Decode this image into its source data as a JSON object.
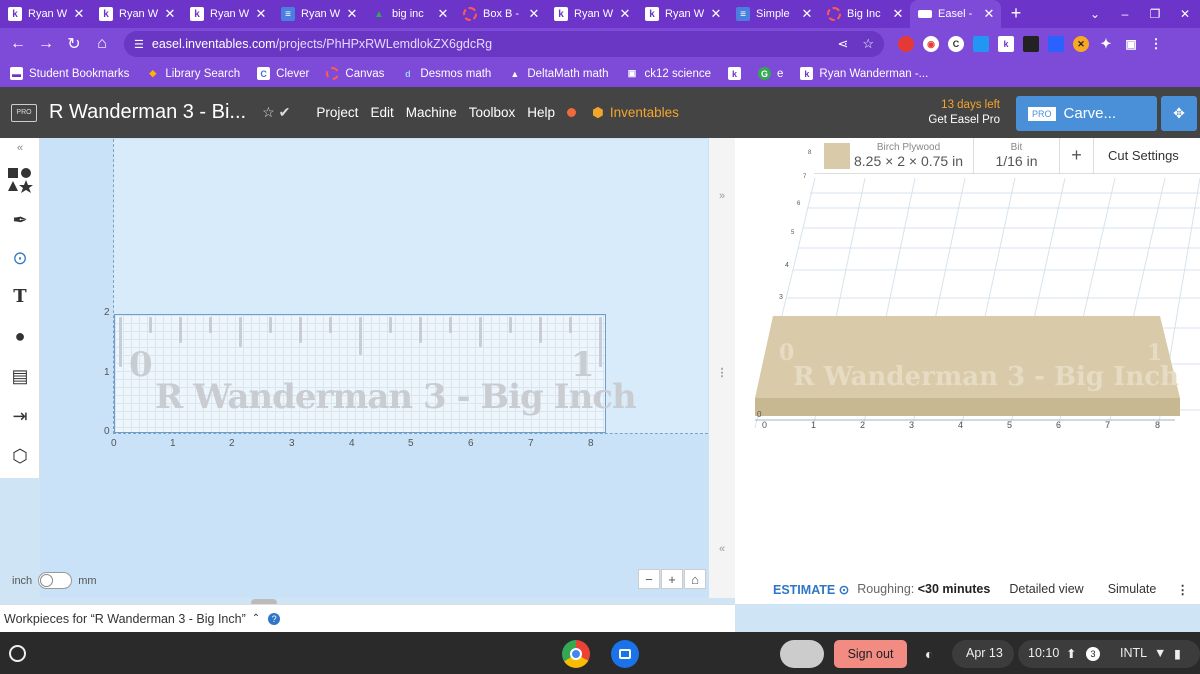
{
  "tabs": [
    {
      "title": "Ryan W",
      "icon": "kami-icon"
    },
    {
      "title": "Ryan W",
      "icon": "kami-icon"
    },
    {
      "title": "Ryan W",
      "icon": "kami-icon"
    },
    {
      "title": "Ryan W",
      "icon": "docs-icon"
    },
    {
      "title": "big inc",
      "icon": "drive-icon"
    },
    {
      "title": "Box B -",
      "icon": "loading-ring-icon"
    },
    {
      "title": "Ryan W",
      "icon": "kami-icon"
    },
    {
      "title": "Ryan W",
      "icon": "kami-icon"
    },
    {
      "title": "Simple",
      "icon": "docs-icon"
    },
    {
      "title": "Big Inc",
      "icon": "loading-ring-icon"
    },
    {
      "title": "Easel -",
      "icon": "easel-icon",
      "active": true
    }
  ],
  "browser": {
    "url_host": "easel.inventables.com",
    "url_path": "/projects/PhHPxRWLemdlokZX6gdcRg"
  },
  "bookmarks": [
    {
      "label": "Student Bookmarks",
      "icon": "folder-icon"
    },
    {
      "label": "Library Search",
      "icon": "library-icon"
    },
    {
      "label": "Clever",
      "icon": "clever-icon"
    },
    {
      "label": "Canvas",
      "icon": "canvas-icon"
    },
    {
      "label": "Desmos math",
      "icon": "desmos-icon"
    },
    {
      "label": "DeltaMath math",
      "icon": "deltamath-icon"
    },
    {
      "label": "ck12 science",
      "icon": "ck12-icon"
    },
    {
      "label": "",
      "icon": "kami-icon"
    },
    {
      "label": "e",
      "icon": "g-icon"
    },
    {
      "label": "Ryan Wanderman -...",
      "icon": "kami-icon"
    }
  ],
  "easel": {
    "pro_logo": "PRO",
    "project_title": "R Wanderman 3 - Bi...",
    "menu": [
      "Project",
      "Edit",
      "Machine",
      "Toolbox",
      "Help"
    ],
    "inventables": "Inventables",
    "trial_days": "13 days left",
    "trial_cta": "Get Easel Pro",
    "carve_label": "Carve...",
    "carve_badge": "PRO"
  },
  "design": {
    "ruler_text": "R Wanderman 3 - Big Inch",
    "mark_start": "0",
    "mark_end": "1",
    "x_ticks": [
      "0",
      "1",
      "2",
      "3",
      "4",
      "5",
      "6",
      "7",
      "8"
    ],
    "y_ticks": [
      "0",
      "1",
      "2"
    ],
    "unit_left": "inch",
    "unit_right": "mm",
    "zoom_out": "−",
    "zoom_in": "+"
  },
  "material": {
    "name": "Birch Plywood",
    "dims": "8.25 × 2 × 0.75 in",
    "bit_caption": "Bit",
    "bit_value": "1/16 in",
    "add": "+",
    "cut_settings": "Cut Settings"
  },
  "preview": {
    "x_ticks": [
      "0",
      "1",
      "2",
      "3",
      "4",
      "5",
      "6",
      "7",
      "8"
    ],
    "y_ticks": [
      "3",
      "4",
      "5",
      "6",
      "7",
      "8"
    ]
  },
  "estimate": {
    "label": "ESTIMATE",
    "roughing_label": "Roughing:",
    "roughing_value": "<30 minutes",
    "detailed": "Detailed view",
    "simulate": "Simulate"
  },
  "workpieces": "Workpieces for “R Wanderman 3 - Big Inch”",
  "shelf": {
    "sign_out": "Sign out",
    "date": "Apr 13",
    "time": "10:10",
    "notifications": "3",
    "ime": "INTL"
  },
  "colors": {
    "tab_strip": "#6c34c9",
    "accent": "#7e4ad8",
    "easel_header": "#444444",
    "carve_button": "#4a90d9",
    "inventables": "#f4a52b",
    "sign_out": "#f28b82"
  }
}
